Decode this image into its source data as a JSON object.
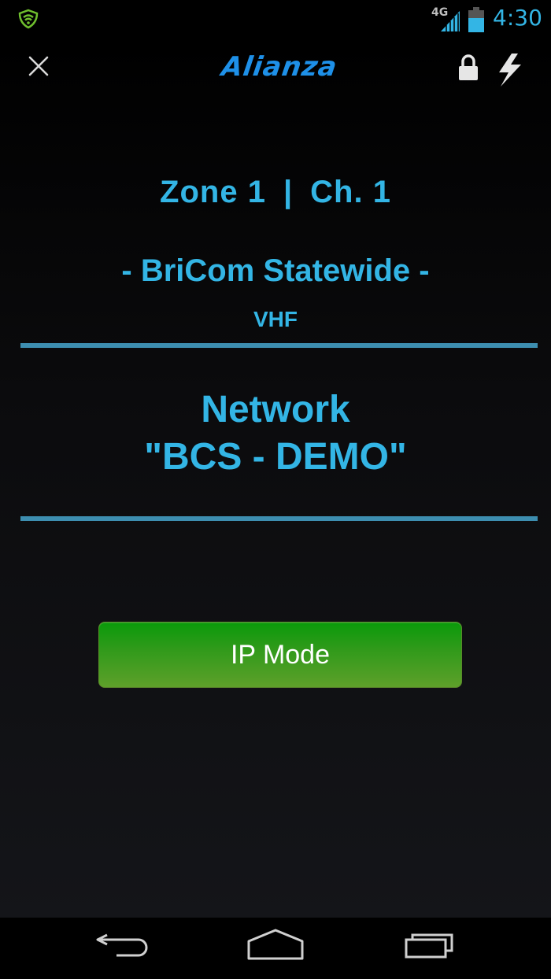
{
  "status_bar": {
    "network_type": "4G",
    "time": "4:30",
    "icons": [
      "lookout-shield-icon",
      "signal-icon",
      "battery-icon"
    ]
  },
  "app_bar": {
    "logo_text": "Alianza",
    "icons": [
      "close-icon",
      "lock-icon",
      "lightning-bolt-icon"
    ]
  },
  "channel": {
    "zone": "Zone 1",
    "separator": "|",
    "channel": "Ch. 1",
    "system_name": "- BriCom Statewide -",
    "band": "VHF"
  },
  "network": {
    "heading": "Network",
    "name": "\"BCS - DEMO\""
  },
  "mode_button": {
    "label": "IP Mode"
  },
  "nav_bar": {
    "icons": [
      "back-icon",
      "home-icon",
      "recent-apps-icon"
    ]
  },
  "colors": {
    "accent": "#33b5e5",
    "logo": "#1e90e8",
    "divider": "#3d8eb0",
    "button_green": "#2f9a1a"
  }
}
